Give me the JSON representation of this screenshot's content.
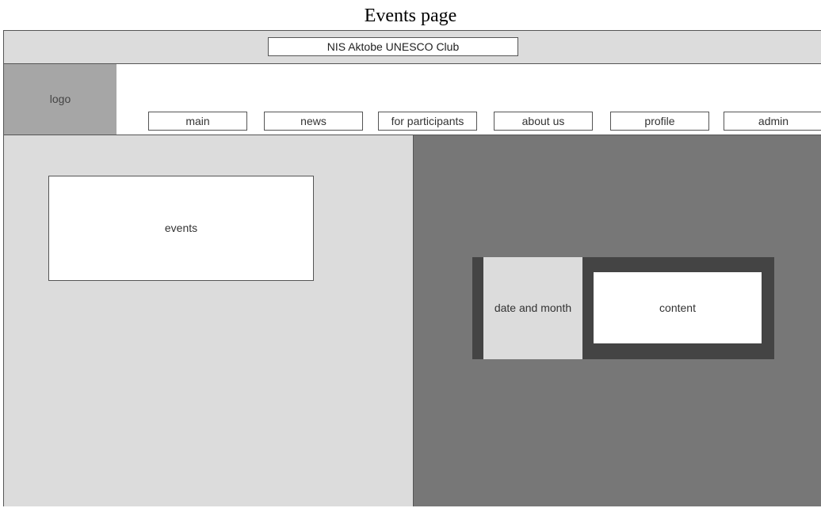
{
  "caption": "Events page",
  "header": {
    "site_title": "NIS Aktobe UNESCO Club",
    "logo_label": "logo"
  },
  "nav": {
    "main": "main",
    "news": "news",
    "participants": "for participants",
    "about": "about us",
    "profile": "profile",
    "admin": "admin"
  },
  "left": {
    "events_label": "events"
  },
  "right": {
    "date_label": "date and month",
    "content_label": "content"
  },
  "colors": {
    "topbar": "#dcdcdc",
    "logo": "#a6a6a6",
    "left_panel": "#dcdcdc",
    "right_panel": "#777777",
    "card": "#444444"
  }
}
